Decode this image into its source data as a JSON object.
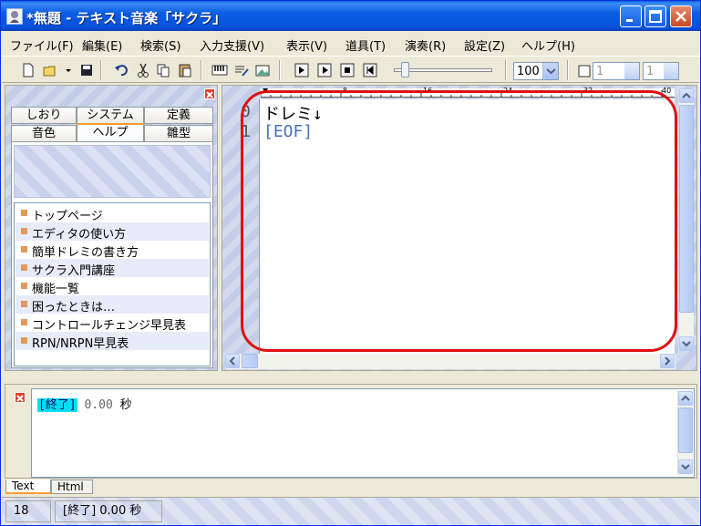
{
  "window": {
    "title": "*無題 - テキスト音楽「サクラ」"
  },
  "menubar": {
    "items": [
      {
        "label": "ファイル(F)"
      },
      {
        "label": "編集(E)"
      },
      {
        "label": "検索(S)"
      },
      {
        "label": "入力支援(V)"
      },
      {
        "label": "表示(V)"
      },
      {
        "label": "道具(T)"
      },
      {
        "label": "演奏(R)"
      },
      {
        "label": "設定(Z)"
      },
      {
        "label": "ヘルプ(H)"
      }
    ]
  },
  "toolbar": {
    "zoom_value": "100",
    "spin1_value": "1",
    "spin2_value": "1"
  },
  "left_panel": {
    "tabs_row1": [
      "しおり",
      "システム",
      "定義"
    ],
    "tabs_row2": [
      "音色",
      "ヘルプ",
      "雛型"
    ],
    "active_tab": "ヘルプ",
    "help_items": [
      "トップページ",
      "エディタの使い方",
      "簡単ドレミの書き方",
      "サクラ入門講座",
      "機能一覧",
      "困ったときは…",
      "コントロールチェンジ早見表",
      "RPN/NRPN早見表"
    ]
  },
  "editor": {
    "ruler_labels": [
      "8",
      "16",
      "24",
      "32",
      "40"
    ],
    "line_numbers": [
      "0",
      "1"
    ],
    "lines": [
      "ドレミ↓",
      "[EOF]"
    ]
  },
  "log": {
    "tag": "[終了]",
    "time": "0.00",
    "unit": "秒"
  },
  "bottom_tabs": [
    "Text",
    "Html"
  ],
  "statusbar": {
    "line": "18",
    "message": "[終了] 0.00 秒"
  },
  "colors": {
    "title_bar": "#0b5de3",
    "highlight_outline": "#e01010",
    "log_tag_bg": "#00e0f0",
    "eof_text": "#4a6fb8"
  }
}
